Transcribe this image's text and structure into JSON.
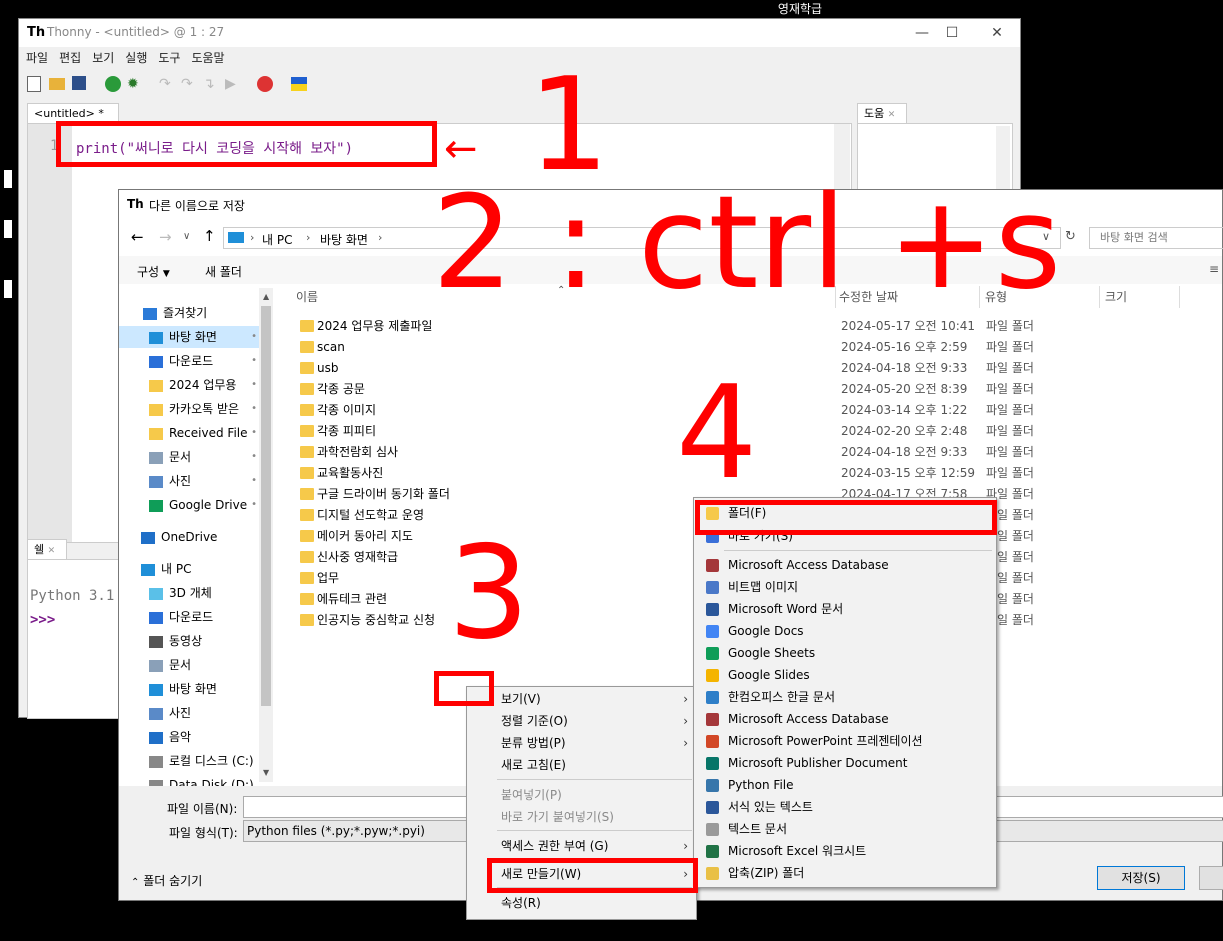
{
  "desktop": {
    "label": "영재학급"
  },
  "thonny": {
    "title": "Thonny  -  <untitled>  @  1 : 27",
    "menu": [
      "파일",
      "편집",
      "보기",
      "실행",
      "도구",
      "도움말"
    ],
    "editor_tab": "<untitled> *",
    "help_tab": "도움",
    "line_number": "1",
    "code": "print(\"써니로 다시 코딩을 시작해 보자\")",
    "shell_tab": "쉘",
    "shell_text": "Python 3.1",
    "prompt": ">>>"
  },
  "dialog": {
    "title": "다른 이름으로 저장",
    "breadcrumb": [
      "내 PC",
      "바탕 화면"
    ],
    "search_placeholder": "바탕 화면 검색",
    "organize": "구성",
    "new_folder": "새 폴더",
    "columns": {
      "name": "이름",
      "date": "수정한 날짜",
      "type": "유형",
      "size": "크기"
    },
    "nav": [
      {
        "label": "즐겨찾기",
        "icon": "star-icon"
      },
      {
        "label": "바탕 화면",
        "icon": "desktop-icon"
      },
      {
        "label": "다운로드",
        "icon": "download-icon"
      },
      {
        "label": "2024 업무용",
        "icon": "folder-icon"
      },
      {
        "label": "카카오톡 받은",
        "icon": "folder-icon"
      },
      {
        "label": "Received File",
        "icon": "folder-icon"
      },
      {
        "label": "문서",
        "icon": "document-icon"
      },
      {
        "label": "사진",
        "icon": "picture-icon"
      },
      {
        "label": "Google Drive",
        "icon": "google-drive-icon"
      },
      {
        "label": "OneDrive",
        "icon": "cloud-icon"
      },
      {
        "label": "내 PC",
        "icon": "pc-icon"
      },
      {
        "label": "3D 개체",
        "icon": "cube-icon"
      },
      {
        "label": "다운로드",
        "icon": "download-icon"
      },
      {
        "label": "동영상",
        "icon": "video-icon"
      },
      {
        "label": "문서",
        "icon": "document-icon"
      },
      {
        "label": "바탕 화면",
        "icon": "desktop-icon"
      },
      {
        "label": "사진",
        "icon": "picture-icon"
      },
      {
        "label": "음악",
        "icon": "music-icon"
      },
      {
        "label": "로컬 디스크 (C:)",
        "icon": "disk-icon"
      },
      {
        "label": "Data Disk (D:)",
        "icon": "disk-icon"
      }
    ],
    "files": [
      {
        "name": "2024 업무용 제출파일",
        "date": "2024-05-17 오전 10:41",
        "type": "파일 폴더"
      },
      {
        "name": "scan",
        "date": "2024-05-16 오후 2:59",
        "type": "파일 폴더"
      },
      {
        "name": "usb",
        "date": "2024-04-18 오전 9:33",
        "type": "파일 폴더"
      },
      {
        "name": "각종 공문",
        "date": "2024-05-20 오전 8:39",
        "type": "파일 폴더"
      },
      {
        "name": "각종 이미지",
        "date": "2024-03-14 오후 1:22",
        "type": "파일 폴더"
      },
      {
        "name": "각종 피피티",
        "date": "2024-02-20 오후 2:48",
        "type": "파일 폴더"
      },
      {
        "name": "과학전람회 심사",
        "date": "2024-04-18 오전 9:33",
        "type": "파일 폴더"
      },
      {
        "name": "교육활동사진",
        "date": "2024-03-15 오후 12:59",
        "type": "파일 폴더"
      },
      {
        "name": "구글 드라이버 동기화 폴더",
        "date": "2024-04-17 오전 7:58",
        "type": "파일 폴더"
      },
      {
        "name": "디지털 선도학교 운영",
        "date": "",
        "type": "파일 폴더"
      },
      {
        "name": "메이커 동아리 지도",
        "date": "",
        "type": "파일 폴더"
      },
      {
        "name": "신사중 영재학급",
        "date": "",
        "type": "파일 폴더"
      },
      {
        "name": "업무",
        "date": "",
        "type": "파일 폴더"
      },
      {
        "name": "에듀테크 관련",
        "date": "",
        "type": "파일 폴더"
      },
      {
        "name": "인공지능 중심학교 신청",
        "date": "",
        "type": "파일 폴더"
      }
    ],
    "filename_label": "파일 이름(N):",
    "filetype_label": "파일 형식(T):",
    "filetype_value": "Python files (*.py;*.pyw;*.pyi)",
    "hide_folders": "폴더 숨기기",
    "save_button": "저장(S)"
  },
  "context_menu": [
    {
      "label": "보기(V)",
      "arrow": true,
      "disabled": false
    },
    {
      "label": "정렬 기준(O)",
      "arrow": true,
      "disabled": false
    },
    {
      "label": "분류 방법(P)",
      "arrow": true,
      "disabled": false
    },
    {
      "label": "새로 고침(E)",
      "arrow": false,
      "disabled": false
    },
    {
      "label": "붙여넣기(P)",
      "arrow": false,
      "disabled": true
    },
    {
      "label": "바로 가기 붙여넣기(S)",
      "arrow": false,
      "disabled": true
    },
    {
      "label": "액세스 권한 부여 (G)",
      "arrow": true,
      "disabled": false
    },
    {
      "label": "새로 만들기(W)",
      "arrow": true,
      "disabled": false
    },
    {
      "label": "속성(R)",
      "arrow": false,
      "disabled": false
    }
  ],
  "submenu": [
    {
      "label": "폴더(F)",
      "icon": "folder-icon",
      "color": "#f6c94a"
    },
    {
      "label": "바로 가기(S)",
      "icon": "shortcut-icon",
      "color": "#3a6fd8"
    },
    {
      "label": "Microsoft Access Database",
      "icon": "access-icon",
      "color": "#a4373a"
    },
    {
      "label": "비트맵 이미지",
      "icon": "bitmap-icon",
      "color": "#4a78c8"
    },
    {
      "label": "Microsoft Word 문서",
      "icon": "word-icon",
      "color": "#2b579a"
    },
    {
      "label": "Google Docs",
      "icon": "google-docs-icon",
      "color": "#4285f4"
    },
    {
      "label": "Google Sheets",
      "icon": "google-sheets-icon",
      "color": "#0f9d58"
    },
    {
      "label": "Google Slides",
      "icon": "google-slides-icon",
      "color": "#f4b400"
    },
    {
      "label": "한컴오피스 한글 문서",
      "icon": "hwp-icon",
      "color": "#2f7fc8"
    },
    {
      "label": "Microsoft Access Database",
      "icon": "access-icon",
      "color": "#a4373a"
    },
    {
      "label": "Microsoft PowerPoint 프레젠테이션",
      "icon": "powerpoint-icon",
      "color": "#d24726"
    },
    {
      "label": "Microsoft Publisher Document",
      "icon": "publisher-icon",
      "color": "#077568"
    },
    {
      "label": "Python File",
      "icon": "python-icon",
      "color": "#3776ab"
    },
    {
      "label": "서식 있는 텍스트",
      "icon": "rtf-icon",
      "color": "#2b579a"
    },
    {
      "label": "텍스트 문서",
      "icon": "text-icon",
      "color": "#9a9a9a"
    },
    {
      "label": "Microsoft Excel 워크시트",
      "icon": "excel-icon",
      "color": "#217346"
    },
    {
      "label": "압축(ZIP) 폴더",
      "icon": "zip-icon",
      "color": "#e9c046"
    }
  ],
  "annotations": {
    "step1": "1",
    "step2": "2 : ctrl +s",
    "step3": "3",
    "step4": "4",
    "color": "#ff0000"
  }
}
